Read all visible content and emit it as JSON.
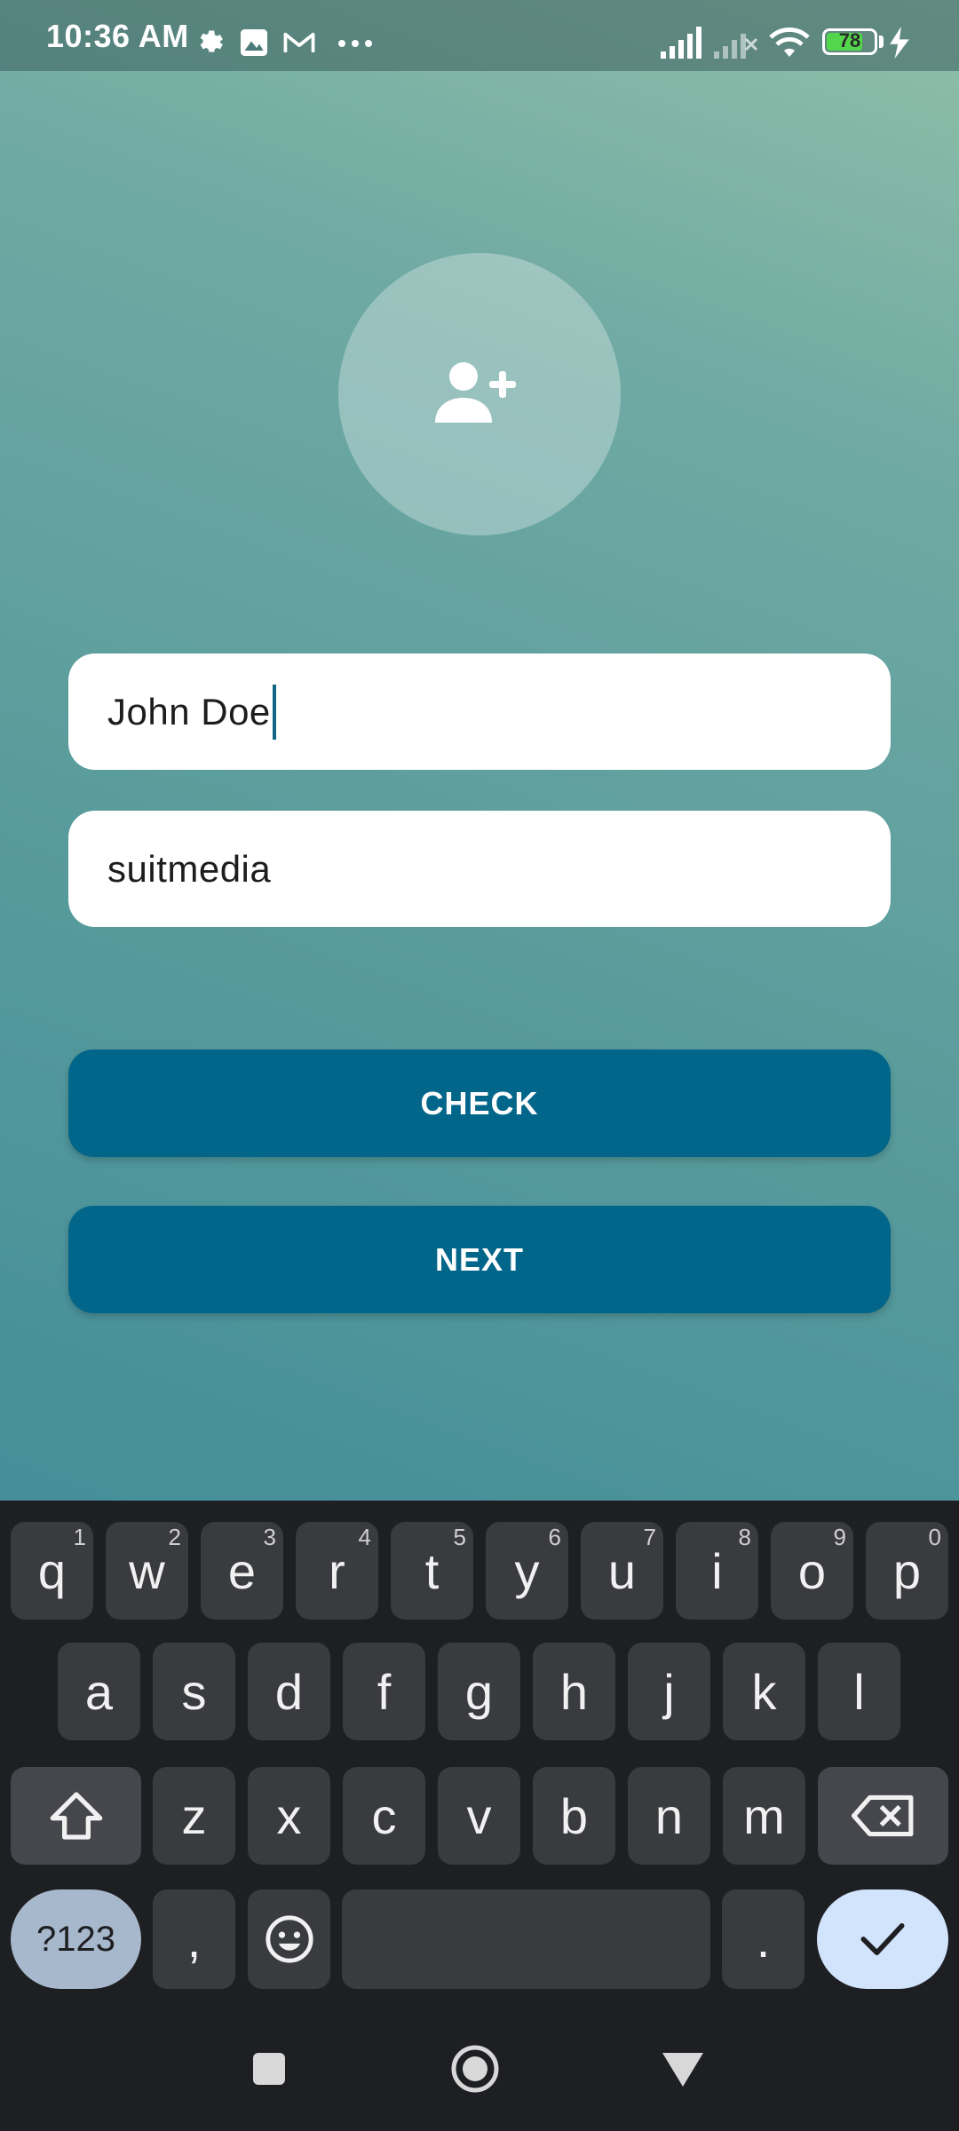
{
  "status_bar": {
    "time": "10:36 AM",
    "battery": "78",
    "icons": [
      "settings-icon",
      "photos-icon",
      "gmail-icon",
      "more-icon",
      "signal-icon",
      "signal-off-icon",
      "wifi-icon",
      "battery-icon",
      "charging-icon"
    ]
  },
  "avatar": {
    "icon": "person-add-icon"
  },
  "form": {
    "name_value": "John Doe",
    "palindrome_value": "suitmedia"
  },
  "buttons": {
    "check_label": "CHECK",
    "next_label": "NEXT"
  },
  "colors": {
    "accent": "#02668a",
    "keyboard_bg": "#1e1f22",
    "key_bg": "#3a3b3f",
    "enter_key": "#d2e3fc",
    "symbols_key": "#a8b8cc",
    "battery_fill": "#53d64c"
  },
  "keyboard": {
    "row1": [
      {
        "k": "q",
        "h": "1"
      },
      {
        "k": "w",
        "h": "2"
      },
      {
        "k": "e",
        "h": "3"
      },
      {
        "k": "r",
        "h": "4"
      },
      {
        "k": "t",
        "h": "5"
      },
      {
        "k": "y",
        "h": "6"
      },
      {
        "k": "u",
        "h": "7"
      },
      {
        "k": "i",
        "h": "8"
      },
      {
        "k": "o",
        "h": "9"
      },
      {
        "k": "p",
        "h": "0"
      }
    ],
    "row2": [
      "a",
      "s",
      "d",
      "f",
      "g",
      "h",
      "j",
      "k",
      "l"
    ],
    "row3": [
      "z",
      "x",
      "c",
      "v",
      "b",
      "n",
      "m"
    ],
    "symbols_label": "?123",
    "comma_label": ",",
    "period_label": ".",
    "icons": [
      "shift-icon",
      "backspace-icon",
      "emoji-icon",
      "check-icon"
    ]
  },
  "navbar": {
    "icons": [
      "recents-icon",
      "home-icon",
      "back-icon"
    ]
  }
}
